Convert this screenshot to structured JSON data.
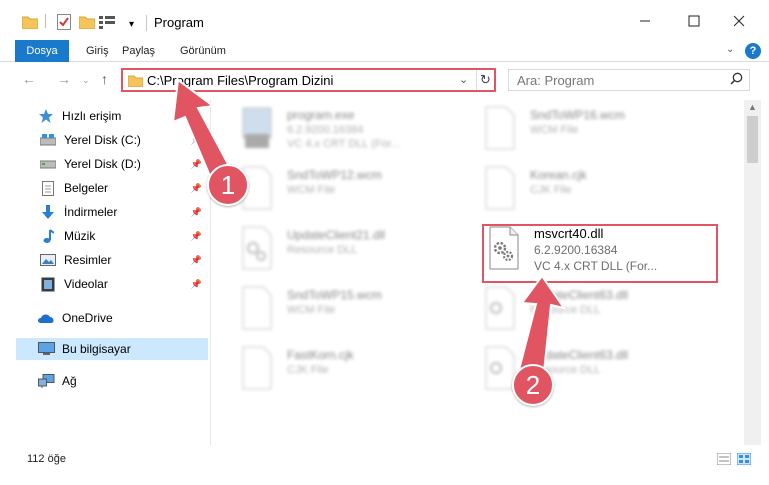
{
  "window": {
    "title": "Program"
  },
  "ribbon": {
    "tabs": [
      "Dosya",
      "Giriş",
      "Paylaş",
      "Görünüm"
    ]
  },
  "address": {
    "path": "C:\\Program Files\\Program Dizini"
  },
  "search": {
    "placeholder": "Ara: Program"
  },
  "sidebar": {
    "items": [
      {
        "label": "Hızlı erişim",
        "icon": "star-icon"
      },
      {
        "label": "Yerel Disk (C:)",
        "icon": "drive-icon"
      },
      {
        "label": "Yerel Disk (D:)",
        "icon": "drive-icon"
      },
      {
        "label": "Belgeler",
        "icon": "documents-icon"
      },
      {
        "label": "İndirmeler",
        "icon": "download-icon"
      },
      {
        "label": "Müzik",
        "icon": "music-icon"
      },
      {
        "label": "Resimler",
        "icon": "pictures-icon"
      },
      {
        "label": "Videolar",
        "icon": "video-icon"
      },
      {
        "label": "OneDrive",
        "icon": "cloud-icon"
      },
      {
        "label": "Bu bilgisayar",
        "icon": "computer-icon"
      },
      {
        "label": "Ağ",
        "icon": "network-icon"
      }
    ]
  },
  "files": [
    {
      "name": "program.exe",
      "line2": "6.2.9200.16384",
      "line3": "VC 4.x CRT DLL (For..."
    },
    {
      "name": "SndToWP16.wcm",
      "line2": "WCM File",
      "line3": ""
    },
    {
      "name": "SndToWP12.wcm",
      "line2": "WCM File",
      "line3": ""
    },
    {
      "name": "Korean.cjk",
      "line2": "CJK File",
      "line3": ""
    },
    {
      "name": "UpdateClient21.dll",
      "line2": "Resource DLL",
      "line3": ""
    },
    {
      "name": "msvcrt40.dll",
      "line2": "6.2.9200.16384",
      "line3": "VC 4.x CRT DLL (For..."
    },
    {
      "name": "SndToWP15.wcm",
      "line2": "WCM File",
      "line3": ""
    },
    {
      "name": "UpdateClient63.dll",
      "line2": "Resource DLL",
      "line3": ""
    },
    {
      "name": "FastKorn.cjk",
      "line2": "CJK File",
      "line3": ""
    },
    {
      "name": "UpdateClient63.dll",
      "line2": "Resource DLL",
      "line3": ""
    }
  ],
  "status": {
    "count": "112 öğe"
  },
  "annotations": {
    "step1": "1",
    "step2": "2",
    "color": "#e05561"
  },
  "colors": {
    "accent": "#1979ca",
    "selection": "#cce8ff"
  }
}
